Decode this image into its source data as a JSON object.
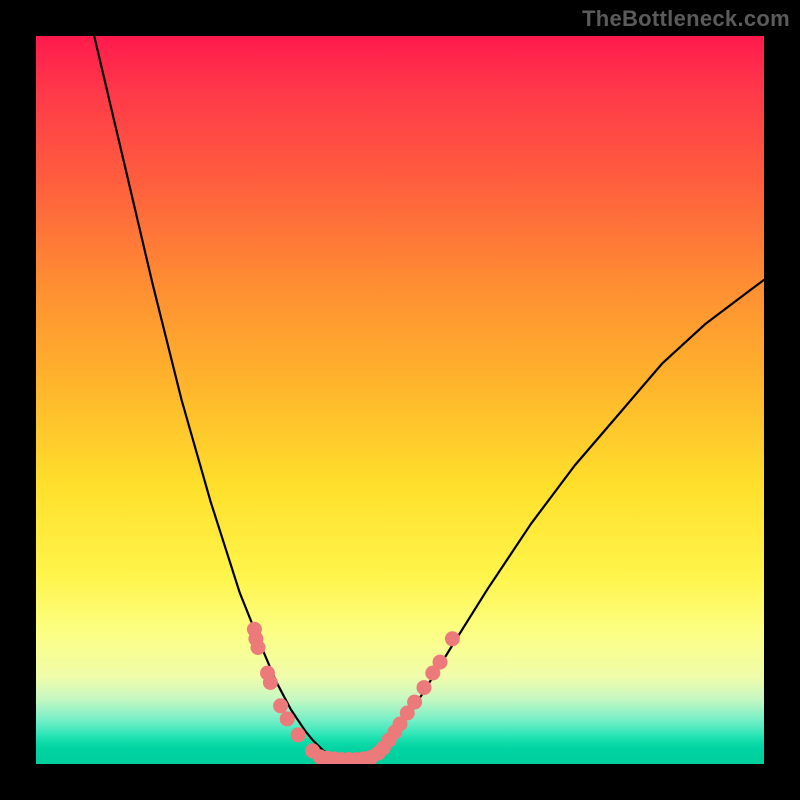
{
  "watermark": "TheBottleneck.com",
  "chart_data": {
    "type": "line",
    "title": "",
    "xlabel": "",
    "ylabel": "",
    "xlim": [
      0,
      1
    ],
    "ylim": [
      0,
      1
    ],
    "grid": false,
    "legend": false,
    "series": [
      {
        "name": "curve",
        "x": [
          0.08,
          0.12,
          0.16,
          0.2,
          0.24,
          0.28,
          0.31,
          0.33,
          0.35,
          0.37,
          0.38,
          0.395,
          0.41,
          0.43,
          0.45,
          0.465,
          0.48,
          0.5,
          0.53,
          0.57,
          0.62,
          0.68,
          0.74,
          0.8,
          0.86,
          0.92,
          0.98,
          1.0
        ],
        "y": [
          1.0,
          0.83,
          0.66,
          0.5,
          0.36,
          0.235,
          0.16,
          0.113,
          0.075,
          0.045,
          0.033,
          0.018,
          0.01,
          0.008,
          0.008,
          0.013,
          0.025,
          0.05,
          0.095,
          0.16,
          0.24,
          0.33,
          0.41,
          0.48,
          0.55,
          0.605,
          0.65,
          0.665
        ]
      }
    ],
    "marker_groups": [
      {
        "name": "left-cluster",
        "color": "#ed7a7a",
        "points": [
          {
            "x": 0.3,
            "y": 0.185
          },
          {
            "x": 0.302,
            "y": 0.172
          },
          {
            "x": 0.305,
            "y": 0.16
          },
          {
            "x": 0.318,
            "y": 0.125
          },
          {
            "x": 0.322,
            "y": 0.112
          },
          {
            "x": 0.336,
            "y": 0.08
          },
          {
            "x": 0.345,
            "y": 0.062
          },
          {
            "x": 0.36,
            "y": 0.04
          },
          {
            "x": 0.38,
            "y": 0.018
          }
        ]
      },
      {
        "name": "valley-cluster",
        "color": "#ed7a7a",
        "points": [
          {
            "x": 0.39,
            "y": 0.01
          },
          {
            "x": 0.4,
            "y": 0.008
          },
          {
            "x": 0.41,
            "y": 0.007
          },
          {
            "x": 0.42,
            "y": 0.006
          },
          {
            "x": 0.43,
            "y": 0.006
          },
          {
            "x": 0.44,
            "y": 0.006
          },
          {
            "x": 0.45,
            "y": 0.007
          },
          {
            "x": 0.46,
            "y": 0.009
          }
        ]
      },
      {
        "name": "right-cluster",
        "color": "#ed7a7a",
        "points": [
          {
            "x": 0.47,
            "y": 0.015
          },
          {
            "x": 0.477,
            "y": 0.022
          },
          {
            "x": 0.485,
            "y": 0.033
          },
          {
            "x": 0.493,
            "y": 0.044
          },
          {
            "x": 0.5,
            "y": 0.055
          },
          {
            "x": 0.51,
            "y": 0.07
          },
          {
            "x": 0.52,
            "y": 0.085
          },
          {
            "x": 0.533,
            "y": 0.105
          },
          {
            "x": 0.545,
            "y": 0.125
          },
          {
            "x": 0.555,
            "y": 0.14
          },
          {
            "x": 0.572,
            "y": 0.172
          }
        ]
      }
    ],
    "background_gradient": {
      "type": "vertical",
      "stops": [
        {
          "pos": 0.0,
          "color": "#ff1a4d"
        },
        {
          "pos": 0.2,
          "color": "#ff5e3e"
        },
        {
          "pos": 0.48,
          "color": "#ffb52b"
        },
        {
          "pos": 0.74,
          "color": "#fff44a"
        },
        {
          "pos": 0.9,
          "color": "#c8f8c2"
        },
        {
          "pos": 1.0,
          "color": "#00cf9e"
        }
      ]
    }
  }
}
